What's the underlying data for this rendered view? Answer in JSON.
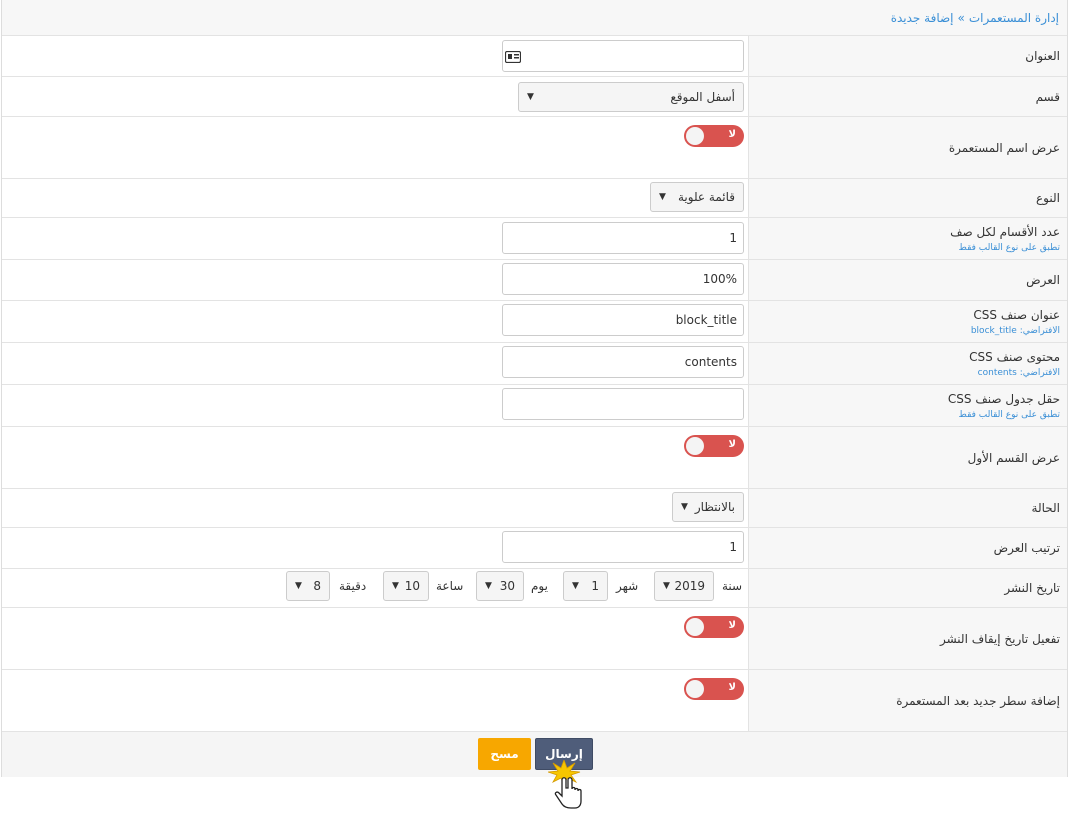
{
  "breadcrumb": {
    "parent": "إدارة المستعمرات",
    "separator": "»",
    "current": "إضافة جديدة"
  },
  "fields": {
    "title": {
      "label": "العنوان",
      "value": "",
      "icon": "id-card-icon"
    },
    "section": {
      "label": "قسم",
      "value": "أسفل الموقع"
    },
    "show_name": {
      "label": "عرض اسم المستعمرة",
      "toggle": "لا"
    },
    "type": {
      "label": "النوع",
      "value": "قائمة علوية"
    },
    "cols": {
      "label": "عدد الأقسام لكل صف",
      "hint": "تطبق على نوع القالب فقط",
      "value": "1"
    },
    "width": {
      "label": "العرض",
      "value": "100%"
    },
    "css_title": {
      "label": "عنوان صنف CSS",
      "hint_prefix": "الافتراضي:",
      "hint_value": "block_title",
      "value": "block_title"
    },
    "css_content": {
      "label": "محتوى صنف CSS",
      "hint_prefix": "الافتراضي:",
      "hint_value": "contents",
      "value": "contents"
    },
    "css_table": {
      "label": "حقل جدول صنف CSS",
      "hint": "تطبق على نوع القالب فقط",
      "value": ""
    },
    "show_first": {
      "label": "عرض القسم الأول",
      "toggle": "لا"
    },
    "status": {
      "label": "الحالة",
      "value": "بالانتظار"
    },
    "order": {
      "label": "ترتيب العرض",
      "value": "1"
    },
    "publish_date": {
      "label": "تاريخ النشر",
      "year_label": "سنة",
      "year": "2019",
      "month_label": "شهر",
      "month": "1",
      "day_label": "يوم",
      "day": "30",
      "hour_label": "ساعة",
      "hour": "10",
      "minute_label": "دقيقة",
      "minute": "8"
    },
    "enable_stop": {
      "label": "تفعيل تاريخ إيقاف النشر",
      "toggle": "لا"
    },
    "new_line": {
      "label": "إضافة سطر جديد بعد المستعمرة",
      "toggle": "لا"
    }
  },
  "buttons": {
    "submit": "إرسال",
    "clear": "مسح"
  },
  "colors": {
    "toggle_off": "#d9534f",
    "submit": "#4f5d7a",
    "clear": "#f7a700",
    "link": "#3a8fd6"
  }
}
